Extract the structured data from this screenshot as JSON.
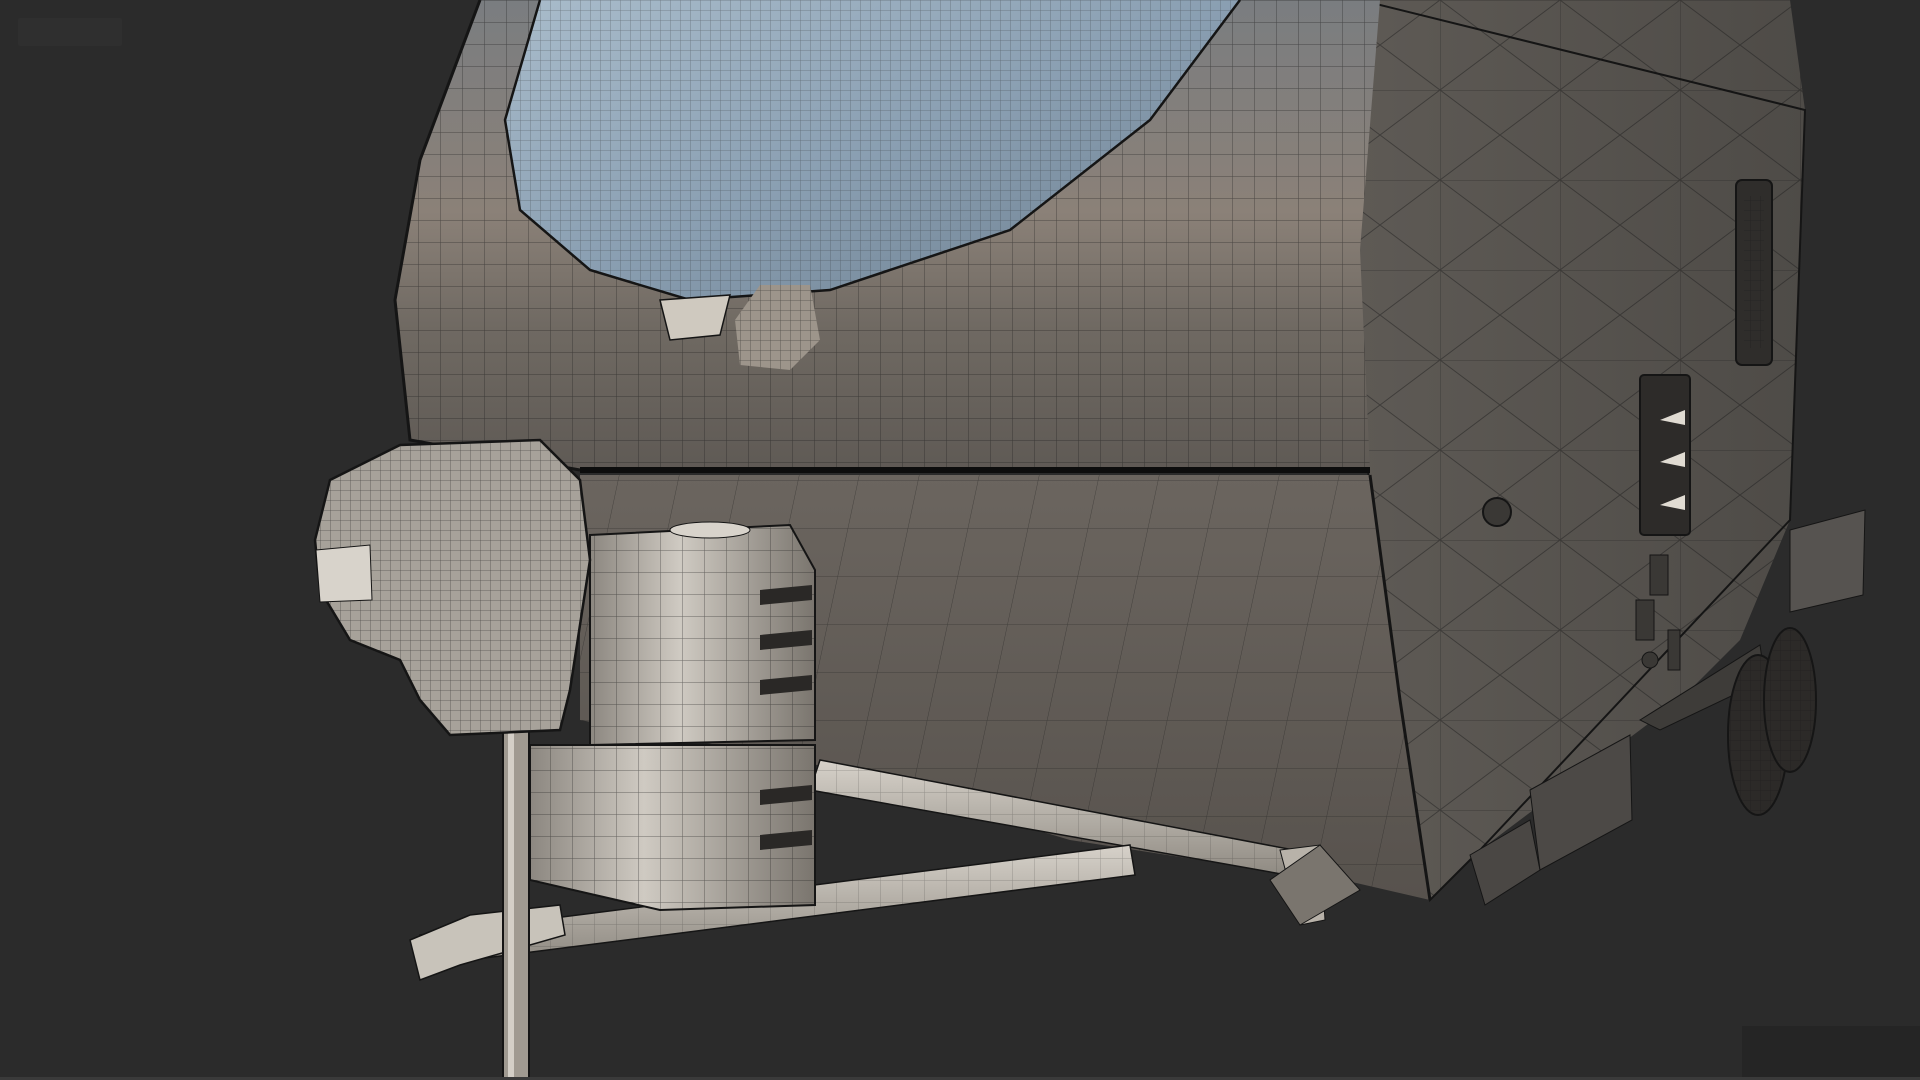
{
  "viewport": {
    "view_label": "",
    "background_color": "#2b2b2b",
    "model_base_color": "#6e6a65",
    "window_glass_color": "#9fb3c4",
    "wireframe_color": "#1a1a1a",
    "highlight_color": "#d8d4cc"
  },
  "scene": {
    "subject": "caravan-wireframe-model",
    "parts": [
      "front-shell",
      "front-window",
      "side-panel",
      "lower-front-panel",
      "gas-bottles",
      "jockey-wheel-post",
      "jockey-head",
      "a-frame-drawbar",
      "side-door-vents",
      "side-window",
      "wheels",
      "rear-bumper"
    ]
  }
}
